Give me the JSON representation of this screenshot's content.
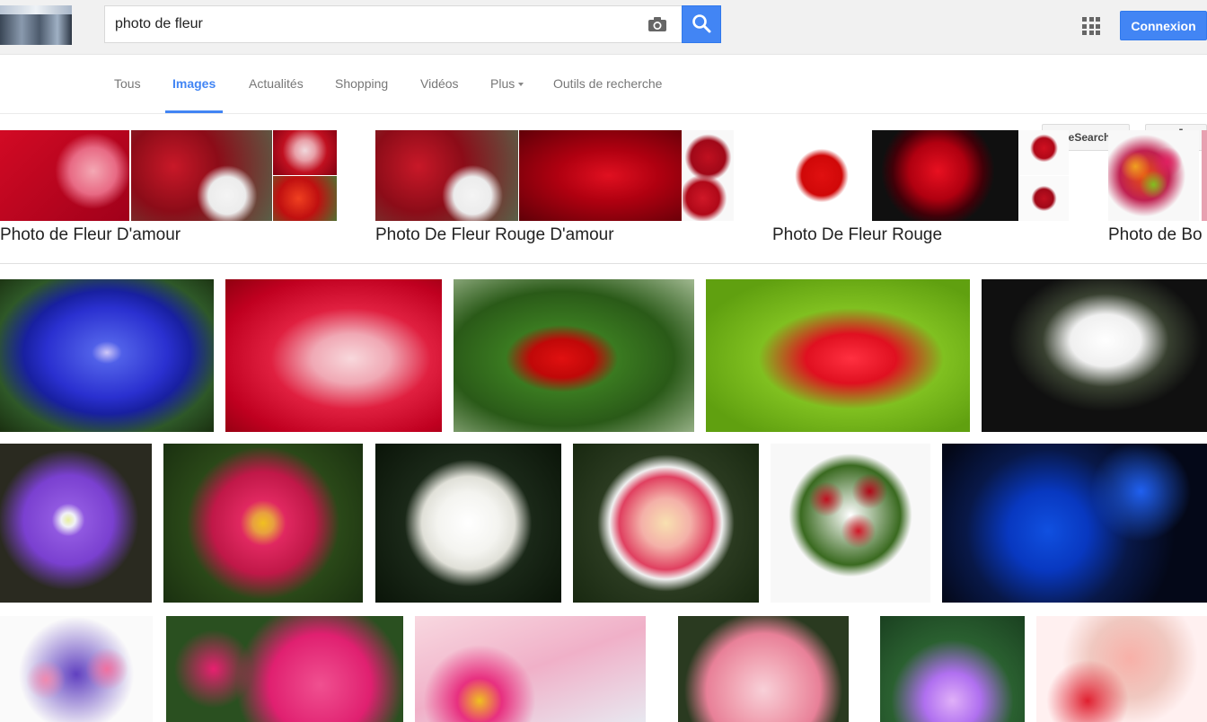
{
  "search": {
    "query": "photo de fleur"
  },
  "header": {
    "login_label": "Connexion"
  },
  "tabs": [
    {
      "label": "Tous"
    },
    {
      "label": "Images"
    },
    {
      "label": "Actualités"
    },
    {
      "label": "Shopping"
    },
    {
      "label": "Vidéos"
    },
    {
      "label": "Plus"
    },
    {
      "label": "Outils de recherche"
    }
  ],
  "safesearch_label": "SafeSearch",
  "related_searches": [
    {
      "label": "Photo de Fleur D'amour"
    },
    {
      "label": "Photo De Fleur Rouge D'amour"
    },
    {
      "label": "Photo De Fleur Rouge"
    },
    {
      "label": "Photo de Bo"
    }
  ],
  "colors": {
    "accent": "#4285f4",
    "tab_text": "#777777",
    "bar_bg": "#f1f1f1"
  },
  "icons": [
    "camera-icon",
    "search-icon",
    "apps-grid-icon",
    "gear-icon",
    "caret-down-icon"
  ]
}
